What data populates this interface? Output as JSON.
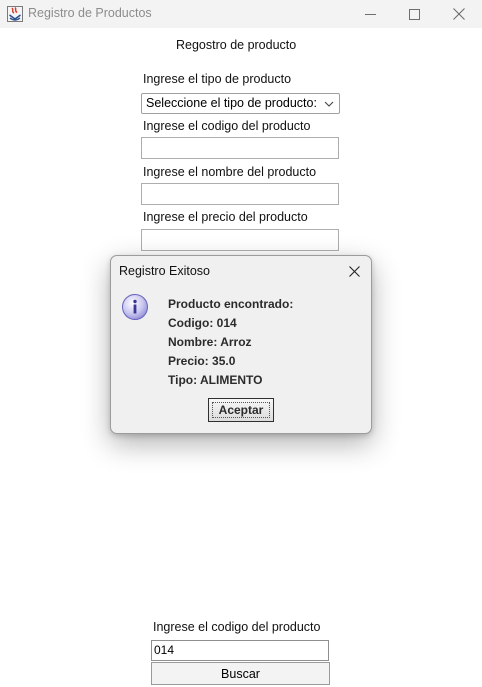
{
  "window": {
    "title": "Registro de Productos",
    "icon": "java-app-icon",
    "controls": [
      "minimize-icon",
      "maximize-icon",
      "close-icon"
    ]
  },
  "form": {
    "heading": "Regostro de producto",
    "type_label": "Ingrese el tipo de producto",
    "type_select_value": "Seleccione el tipo de producto:",
    "code_label": "Ingrese el codigo del producto",
    "code_value": "",
    "name_label": "Ingrese el nombre del producto",
    "name_value": "",
    "price_label": "Ingrese el precio del producto",
    "price_value": ""
  },
  "dialog": {
    "title": "Registro Exitoso",
    "icon": "info-icon",
    "lines": [
      "Producto encontrado:",
      "Codigo: 014",
      "Nombre: Arroz",
      "Precio: 35.0",
      "Tipo: ALIMENTO"
    ],
    "ok_label": "Aceptar"
  },
  "search": {
    "label": "Ingrese el codigo del producto",
    "value": "014",
    "button_label": "Buscar"
  }
}
